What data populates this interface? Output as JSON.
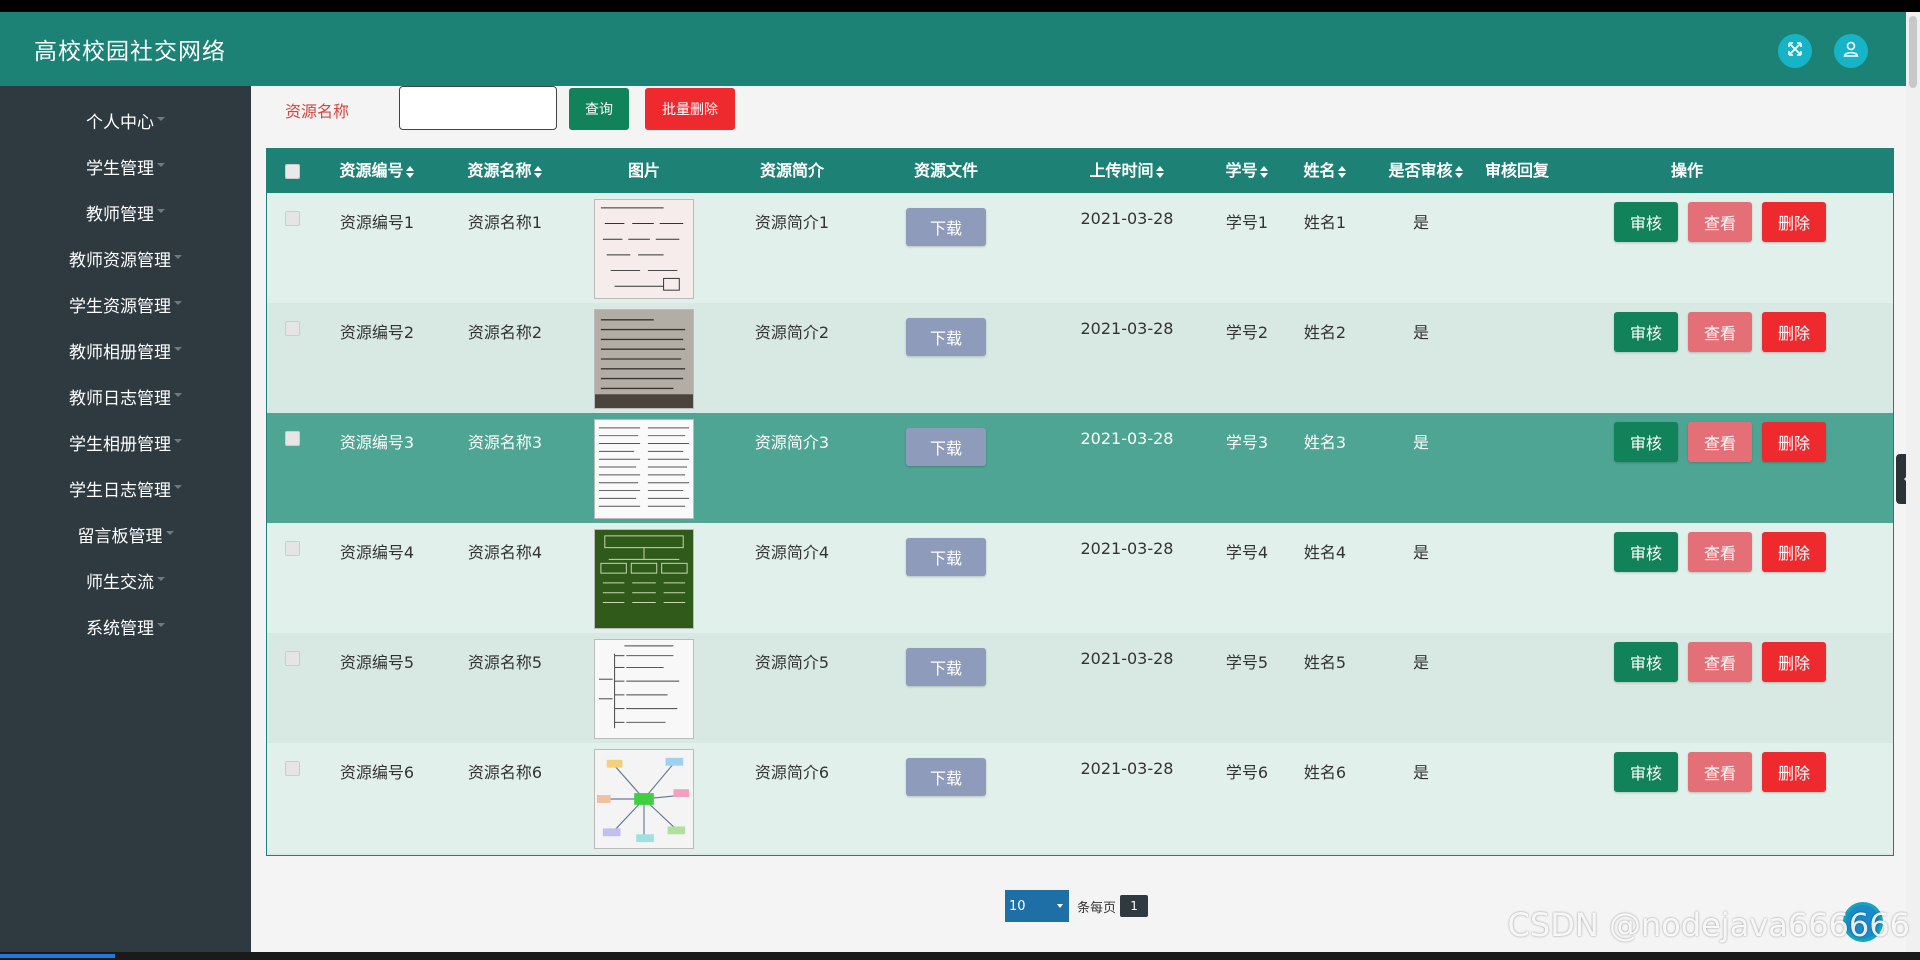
{
  "app": {
    "title": "高校校园社交网络"
  },
  "header_icons": [
    "fullscreen-icon",
    "user-icon"
  ],
  "sidebar": {
    "items": [
      {
        "label": "个人中心"
      },
      {
        "label": "学生管理"
      },
      {
        "label": "教师管理"
      },
      {
        "label": "教师资源管理"
      },
      {
        "label": "学生资源管理"
      },
      {
        "label": "教师相册管理"
      },
      {
        "label": "教师日志管理"
      },
      {
        "label": "学生相册管理"
      },
      {
        "label": "学生日志管理"
      },
      {
        "label": "留言板管理"
      },
      {
        "label": "师生交流"
      },
      {
        "label": "系统管理"
      }
    ]
  },
  "search": {
    "label": "资源名称",
    "value": "",
    "query_button": "查询",
    "batch_delete_button": "批量删除"
  },
  "table": {
    "columns": [
      "资源编号",
      "资源名称",
      "图片",
      "资源简介",
      "资源文件",
      "上传时间",
      "学号",
      "姓名",
      "是否审核",
      "审核回复",
      "操作"
    ],
    "rows": [
      {
        "id": "资源编号1",
        "name": "资源名称1",
        "intro": "资源简介1",
        "file_button": "下载",
        "time": "2021-03-28",
        "student_no": "学号1",
        "student_name": "姓名1",
        "audited": "是",
        "reply": "",
        "audit": "审核",
        "view": "查看",
        "delete": "删除"
      },
      {
        "id": "资源编号2",
        "name": "资源名称2",
        "intro": "资源简介2",
        "file_button": "下载",
        "time": "2021-03-28",
        "student_no": "学号2",
        "student_name": "姓名2",
        "audited": "是",
        "reply": "",
        "audit": "审核",
        "view": "查看",
        "delete": "删除"
      },
      {
        "id": "资源编号3",
        "name": "资源名称3",
        "intro": "资源简介3",
        "file_button": "下载",
        "time": "2021-03-28",
        "student_no": "学号3",
        "student_name": "姓名3",
        "audited": "是",
        "reply": "",
        "audit": "审核",
        "view": "查看",
        "delete": "删除"
      },
      {
        "id": "资源编号4",
        "name": "资源名称4",
        "intro": "资源简介4",
        "file_button": "下载",
        "time": "2021-03-28",
        "student_no": "学号4",
        "student_name": "姓名4",
        "audited": "是",
        "reply": "",
        "audit": "审核",
        "view": "查看",
        "delete": "删除"
      },
      {
        "id": "资源编号5",
        "name": "资源名称5",
        "intro": "资源简介5",
        "file_button": "下载",
        "time": "2021-03-28",
        "student_no": "学号5",
        "student_name": "姓名5",
        "audited": "是",
        "reply": "",
        "audit": "审核",
        "view": "查看",
        "delete": "删除"
      },
      {
        "id": "资源编号6",
        "name": "资源名称6",
        "intro": "资源简介6",
        "file_button": "下载",
        "time": "2021-03-28",
        "student_no": "学号6",
        "student_name": "姓名6",
        "audited": "是",
        "reply": "",
        "audit": "审核",
        "view": "查看",
        "delete": "删除"
      }
    ]
  },
  "pagination": {
    "page_size": "10",
    "per_page_label": "条每页",
    "current_page": "1"
  },
  "watermark": "CSDN @nodejava666666",
  "colors": {
    "header": "#1b8275",
    "sidebar": "#2e3a40",
    "table_header": "#1d8275",
    "row_hover": "#4fa593",
    "audit_button": "#12825a",
    "view_button": "#e46f77",
    "delete_button": "#ee2a2f",
    "download_button": "#8f9bbb"
  }
}
